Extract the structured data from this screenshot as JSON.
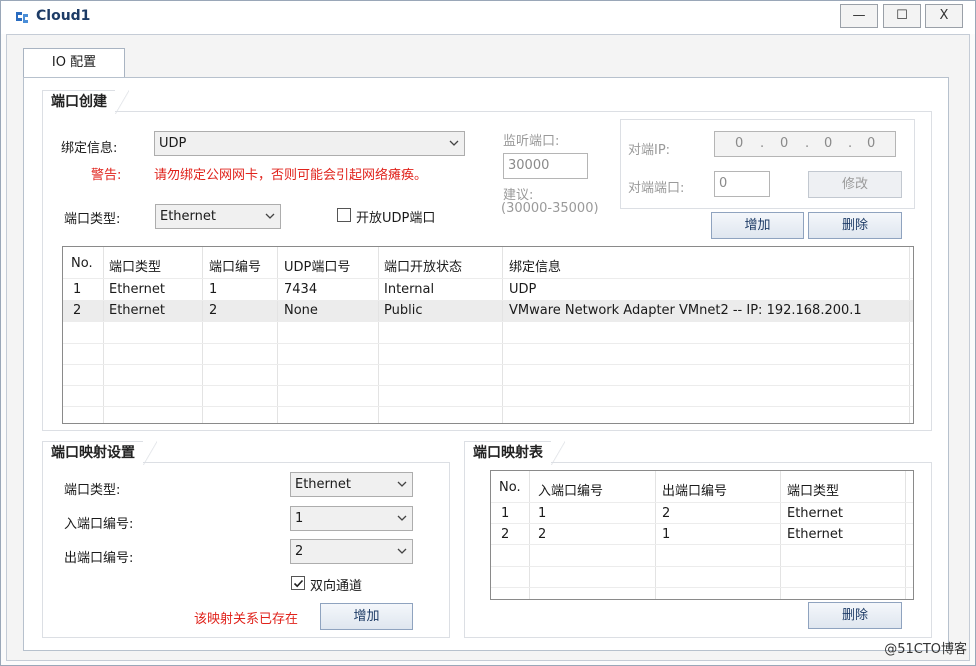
{
  "window": {
    "title": "Cloud1",
    "min": "—",
    "max": "☐",
    "close": "X"
  },
  "tabs": [
    {
      "label": "IO 配置"
    }
  ],
  "port_create": {
    "legend": "端口创建",
    "bind_label": "绑定信息:",
    "bind_value": "UDP",
    "warning_label": "警告:",
    "warning_text": "请勿绑定公网网卡，否则可能会引起网络瘫痪。",
    "port_type_label": "端口类型:",
    "port_type_value": "Ethernet",
    "open_udp_label": "开放UDP端口",
    "listen_port_label": "监听端口:",
    "listen_port_value": "30000",
    "suggest_label": "建议:",
    "suggest_range": "(30000-35000)",
    "peer_ip_label": "对端IP:",
    "peer_ip_octets": [
      "0",
      "0",
      "0",
      "0"
    ],
    "peer_port_label": "对端端口:",
    "peer_port_value": "0",
    "modify_button": "修改",
    "add_button": "增加",
    "delete_button": "删除",
    "table": {
      "headers": [
        "No.",
        "端口类型",
        "端口编号",
        "UDP端口号",
        "端口开放状态",
        "绑定信息"
      ],
      "rows": [
        [
          "1",
          "Ethernet",
          "1",
          "7434",
          "Internal",
          "UDP"
        ],
        [
          "2",
          "Ethernet",
          "2",
          "None",
          "Public",
          "VMware Network Adapter VMnet2 -- IP: 192.168.200.1"
        ]
      ]
    }
  },
  "mapping_settings": {
    "legend": "端口映射设置",
    "port_type_label": "端口类型:",
    "port_type_value": "Ethernet",
    "in_port_label": "入端口编号:",
    "in_port_value": "1",
    "out_port_label": "出端口编号:",
    "out_port_value": "2",
    "bidirectional_label": "双向通道",
    "exists_warning": "该映射关系已存在",
    "add_button": "增加"
  },
  "mapping_table": {
    "legend": "端口映射表",
    "headers": [
      "No.",
      "入端口编号",
      "出端口编号",
      "端口类型"
    ],
    "rows": [
      [
        "1",
        "1",
        "2",
        "Ethernet"
      ],
      [
        "2",
        "2",
        "1",
        "Ethernet"
      ]
    ],
    "delete_button": "删除"
  },
  "watermark": "@51CTO博客",
  "colors": {
    "warning": "#e0231c",
    "title": "#1d3b66"
  }
}
